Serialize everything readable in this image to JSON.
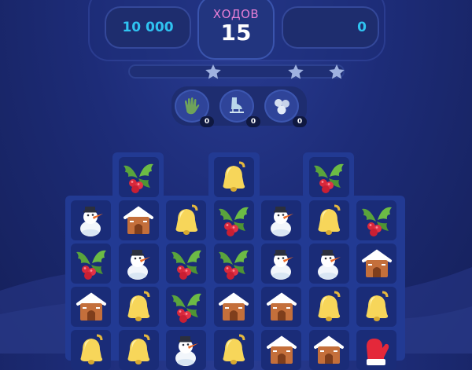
{
  "hud": {
    "score": "10 000",
    "moves_label": "ХОДОВ",
    "moves_value": "15",
    "right_value": "0"
  },
  "boosters": [
    {
      "icon": "glove-icon",
      "count": "0"
    },
    {
      "icon": "skate-icon",
      "count": "0"
    },
    {
      "icon": "snowballs-icon",
      "count": "0"
    }
  ],
  "stars": {
    "count": 3,
    "filled": 0
  },
  "board": {
    "columns": 7,
    "top_row": [
      {
        "col": 1,
        "item": "holly"
      },
      {
        "col": 3,
        "item": "bell"
      },
      {
        "col": 5,
        "item": "holly"
      }
    ],
    "rows": [
      [
        "snowman",
        "gingerbread",
        "bell",
        "holly",
        "snowman",
        "bell",
        "holly"
      ],
      [
        "holly",
        "snowman",
        "holly",
        "holly",
        "snowman",
        "snowman",
        "gingerbread"
      ],
      [
        "gingerbread",
        "bell",
        "holly",
        "gingerbread",
        "gingerbread",
        "bell",
        "bell"
      ],
      [
        "bell",
        "bell",
        "snowman",
        "bell",
        "gingerbread",
        "gingerbread",
        "mitten"
      ]
    ]
  },
  "colors": {
    "score": "#2fc3f1",
    "moves_label": "#e77fd6",
    "background": "#1d2c78"
  }
}
